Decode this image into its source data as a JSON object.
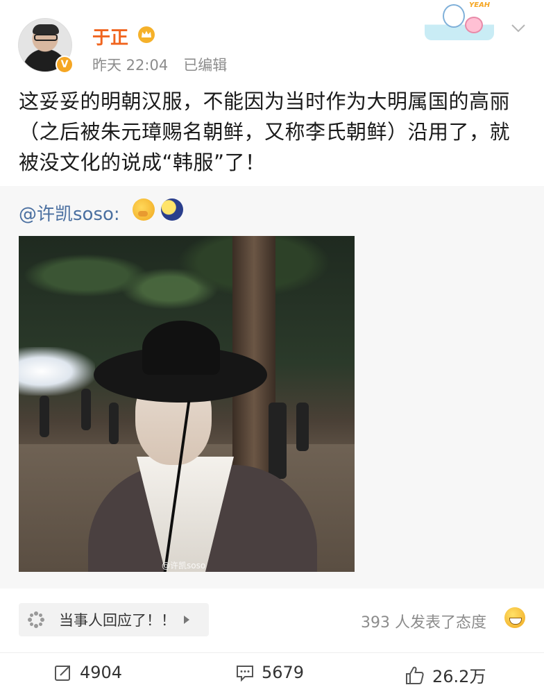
{
  "post": {
    "author": "于正",
    "time": "昨天 22:04",
    "edited": "已编辑",
    "text": "这妥妥的明朝汉服，不能因为当时作为大明属国的高丽（之后被朱元璋赐名朝鲜，又称李氏朝鲜）沿用了，就被没文化的说成“韩服”了！"
  },
  "repost": {
    "author_mention": "@许凯soso:",
    "watermark": "@许凯soso"
  },
  "reaction": {
    "label": "当事人回应了！！",
    "count_text": "393 人发表了态度"
  },
  "actions": {
    "repost_count": "4904",
    "comment_count": "5679",
    "like_count": "26.2万"
  },
  "colors": {
    "username": "#f0641e",
    "mention": "#4a6fa0",
    "meta": "#8c8c8c"
  },
  "icons": [
    "crown-icon",
    "verified-badge-icon",
    "chevron-down-icon",
    "thinking-emoji-icon",
    "moon-emoji-icon",
    "flower-icon",
    "play-icon",
    "grin-emoji-icon",
    "repost-icon",
    "comment-icon",
    "like-icon"
  ]
}
